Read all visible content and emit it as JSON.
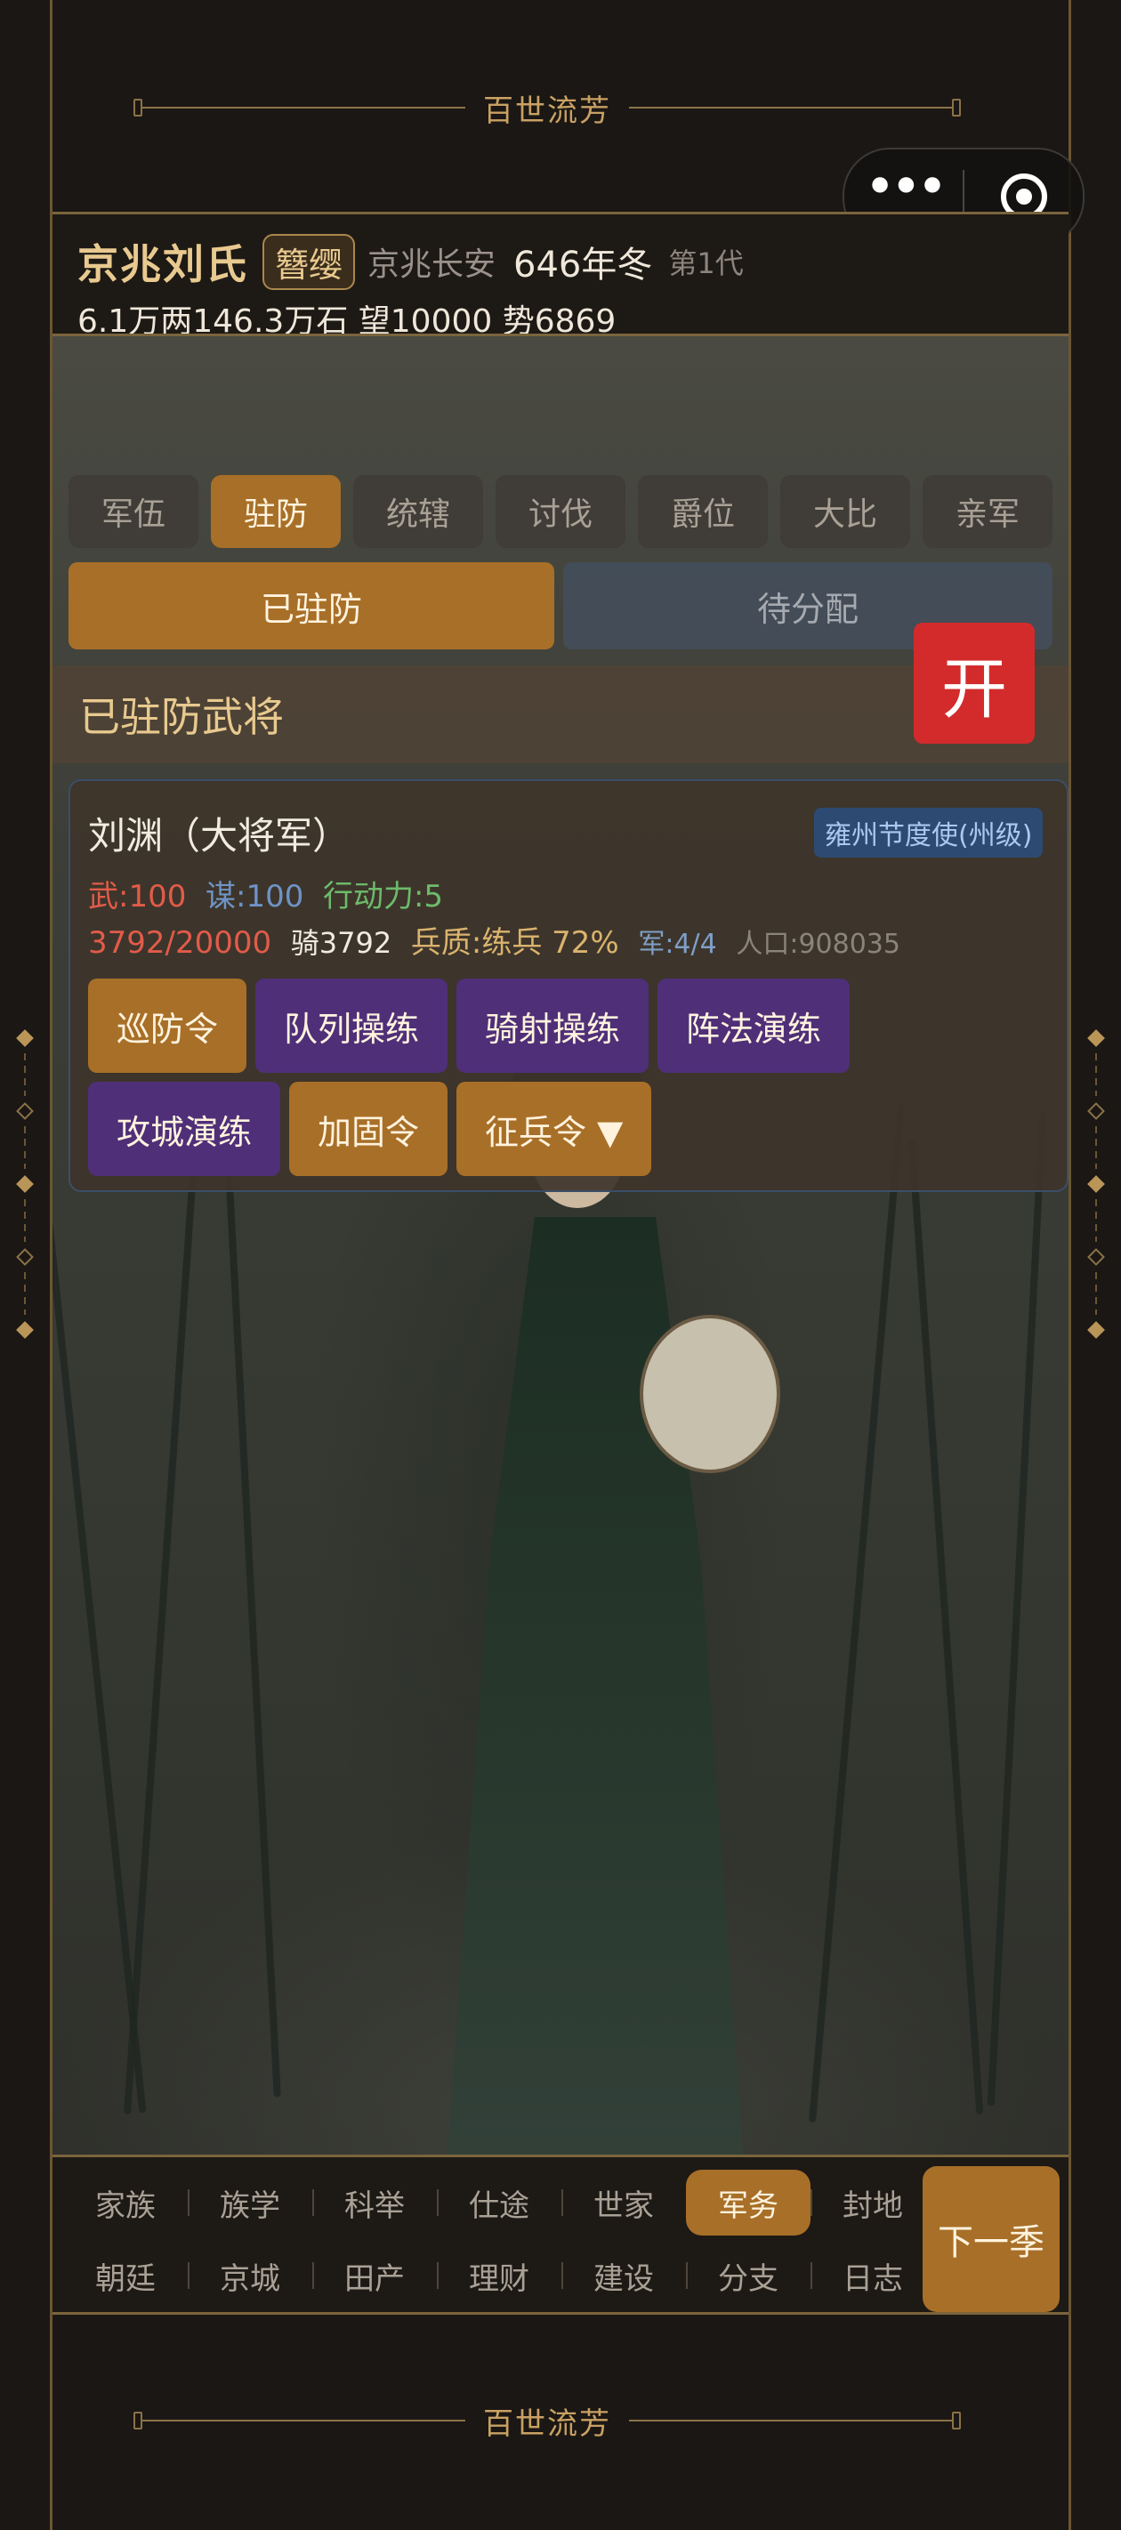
{
  "brand": {
    "title": "百世流芳"
  },
  "header": {
    "clan": "京兆刘氏",
    "badge": "簪缨",
    "city": "京兆长安",
    "year": "646年冬",
    "generation": "第1代",
    "resources": "6.1万两146.3万石  望10000 势6869"
  },
  "tabs": [
    "军伍",
    "驻防",
    "统辖",
    "讨伐",
    "爵位",
    "大比",
    "亲军"
  ],
  "active_tab": "驻防",
  "segments": {
    "stationed": "已驻防",
    "unassigned": "待分配"
  },
  "section_title": "已驻防武将",
  "open_button": "开",
  "general": {
    "name": "刘渊（大将军）",
    "post": "雍州节度使(州级)",
    "wu": "武:100",
    "mou": "谋:100",
    "action": "行动力:5",
    "troops": "3792/20000",
    "cavalry": "骑3792",
    "quality": "兵质:练兵 72%",
    "army": "军:4/4",
    "population": "人口:908035",
    "actions": [
      {
        "label": "巡防令",
        "style": "orange"
      },
      {
        "label": "队列操练",
        "style": "purple"
      },
      {
        "label": "骑射操练",
        "style": "purple"
      },
      {
        "label": "阵法演练",
        "style": "purple"
      },
      {
        "label": "攻城演练",
        "style": "purple"
      },
      {
        "label": "加固令",
        "style": "orange"
      },
      {
        "label": "征兵令 ▼",
        "style": "orange"
      }
    ]
  },
  "bottom_nav": {
    "row1": [
      "家族",
      "族学",
      "科举",
      "仕途",
      "世家",
      "军务",
      "封地"
    ],
    "row2": [
      "朝廷",
      "京城",
      "田产",
      "理财",
      "建设",
      "分支",
      "日志"
    ],
    "active": "军务",
    "next": "下一季"
  },
  "colors": {
    "accent": "#a86f28",
    "purple": "#4f2f78",
    "danger": "#d32b2b",
    "gold_text": "#e8c98f"
  }
}
